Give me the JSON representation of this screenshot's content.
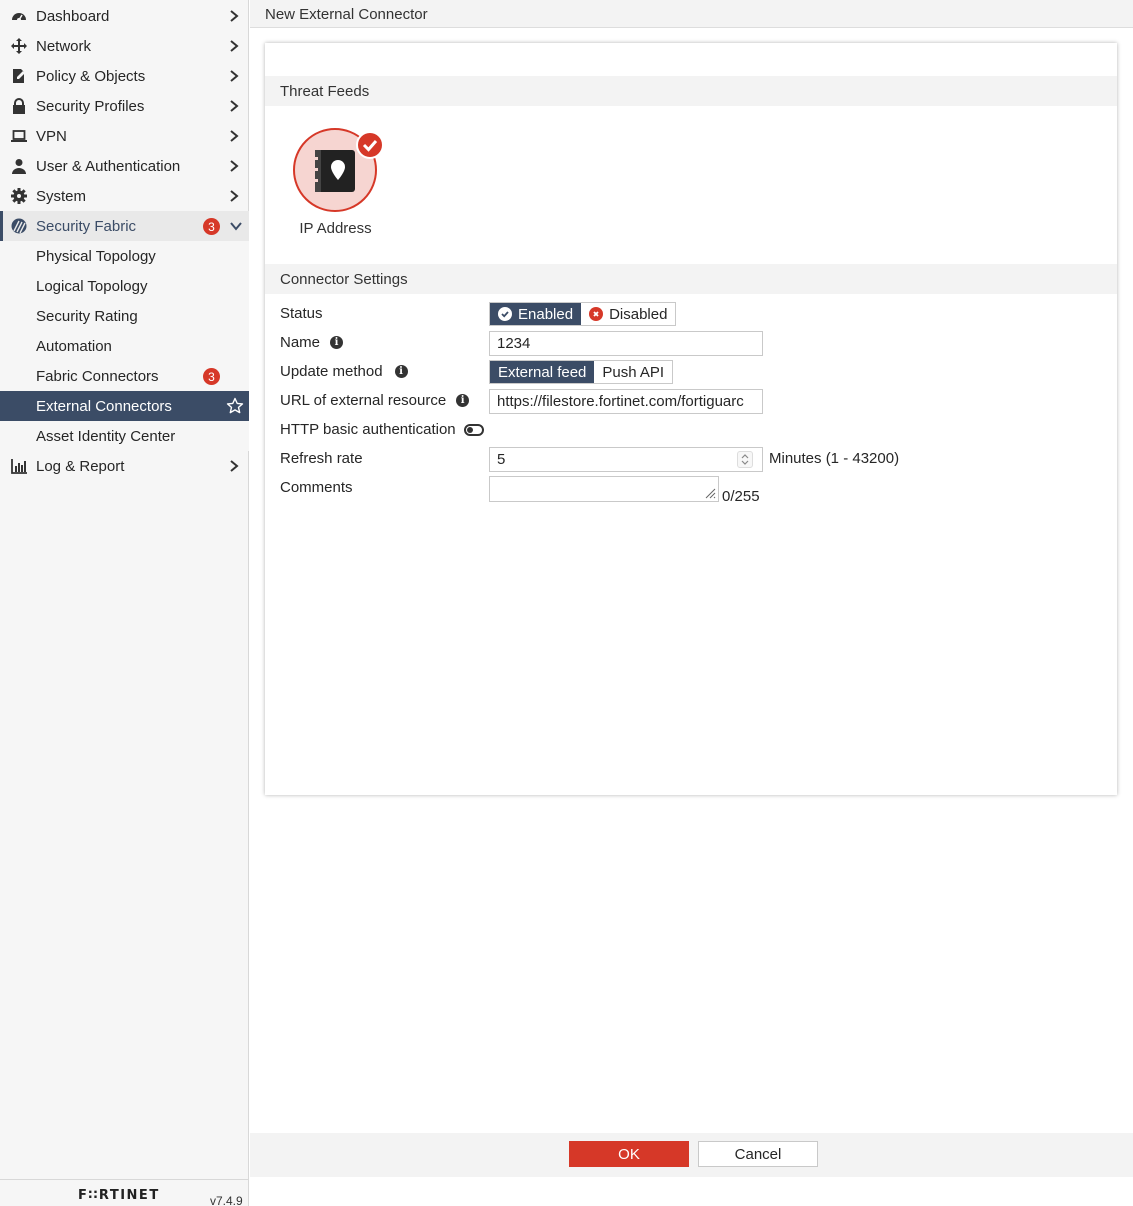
{
  "sidebar": {
    "items": [
      {
        "label": "Dashboard",
        "icon": "dashboard-icon"
      },
      {
        "label": "Network",
        "icon": "network-icon"
      },
      {
        "label": "Policy & Objects",
        "icon": "policy-icon"
      },
      {
        "label": "Security Profiles",
        "icon": "lock-icon"
      },
      {
        "label": "VPN",
        "icon": "laptop-icon"
      },
      {
        "label": "User & Authentication",
        "icon": "user-icon"
      },
      {
        "label": "System",
        "icon": "gear-icon"
      },
      {
        "label": "Security Fabric",
        "icon": "security-fabric-icon",
        "badge": "3"
      },
      {
        "label": "Log & Report",
        "icon": "chart-icon"
      }
    ],
    "sub_items": [
      {
        "label": "Physical Topology"
      },
      {
        "label": "Logical Topology"
      },
      {
        "label": "Security Rating"
      },
      {
        "label": "Automation"
      },
      {
        "label": "Fabric Connectors",
        "badge": "3"
      },
      {
        "label": "External Connectors"
      },
      {
        "label": "Asset Identity Center"
      }
    ],
    "logo": "F∷RTINET",
    "version": "v7.4.9"
  },
  "header": {
    "title": "New External Connector"
  },
  "threat_feeds": {
    "title": "Threat Feeds",
    "card_label": "IP Address"
  },
  "connector_settings": {
    "title": "Connector Settings",
    "status_label": "Status",
    "status_enabled": "Enabled",
    "status_disabled": "Disabled",
    "name_label": "Name",
    "name_value": "1234",
    "update_method_label": "Update method",
    "update_external": "External feed",
    "update_push": "Push API",
    "url_label": "URL of external resource",
    "url_value": "https://filestore.fortinet.com/fortiguarc",
    "http_auth_label": "HTTP basic authentication",
    "refresh_label": "Refresh rate",
    "refresh_value": "5",
    "refresh_unit": "Minutes (1 - 43200)",
    "comments_label": "Comments",
    "comments_counter": "0/255"
  },
  "footer": {
    "ok": "OK",
    "cancel": "Cancel"
  },
  "colors": {
    "accent": "#d63828",
    "nav_selected": "#3b4c66"
  }
}
